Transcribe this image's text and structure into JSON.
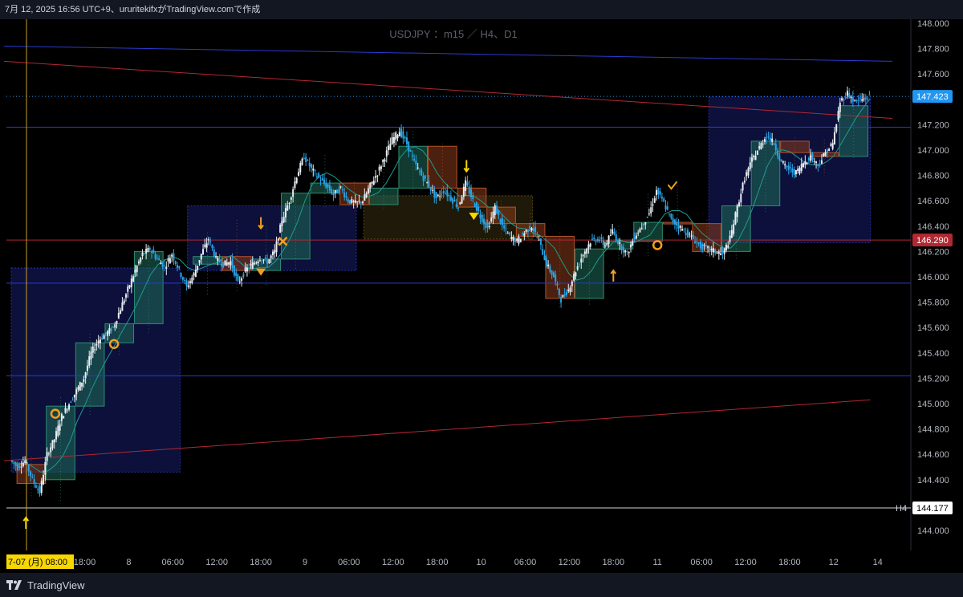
{
  "header": {
    "text": "7月 12, 2025 16:56 UTC+9、ururitekifxがTradingView.comで作成"
  },
  "footer": {
    "brand": "TradingView"
  },
  "chart_data": {
    "type": "candlestick",
    "symbol_label": "USDJPY ：m15 ／ H4、D1",
    "y_ticks": [
      "148.000",
      "147.800",
      "147.600",
      "147.400",
      "147.200",
      "147.000",
      "146.800",
      "146.600",
      "146.400",
      "146.200",
      "146.000",
      "145.800",
      "145.600",
      "145.400",
      "145.200",
      "145.000",
      "144.800",
      "144.600",
      "144.400",
      "144.200",
      "144.000"
    ],
    "ylim": [
      143.85,
      148.05
    ],
    "x_ticks": [
      {
        "t": 0,
        "label": "7-07 (月)  08:00",
        "highlight": true
      },
      {
        "t": 10,
        "label": "18:00"
      },
      {
        "t": 16,
        "label": "8"
      },
      {
        "t": 22,
        "label": "06:00"
      },
      {
        "t": 28,
        "label": "12:00"
      },
      {
        "t": 34,
        "label": "18:00"
      },
      {
        "t": 40,
        "label": "9"
      },
      {
        "t": 46,
        "label": "06:00"
      },
      {
        "t": 52,
        "label": "12:00"
      },
      {
        "t": 58,
        "label": "18:00"
      },
      {
        "t": 64,
        "label": "10"
      },
      {
        "t": 70,
        "label": "06:00"
      },
      {
        "t": 76,
        "label": "12:00"
      },
      {
        "t": 82,
        "label": "18:00"
      },
      {
        "t": 88,
        "label": "11"
      },
      {
        "t": 94,
        "label": "06:00"
      },
      {
        "t": 100,
        "label": "12:00"
      },
      {
        "t": 106,
        "label": "18:00"
      },
      {
        "t": 112,
        "label": "12"
      },
      {
        "t": 118,
        "label": "14"
      }
    ],
    "price_labels": [
      {
        "value": 147.423,
        "label": "147.423",
        "color": "#2196f3",
        "text_color": "#ffffff"
      },
      {
        "value": 146.29,
        "label": "146.290",
        "color": "#b22833",
        "text_color": "#ffffff"
      },
      {
        "value": 144.177,
        "label": "144.177",
        "color": "#ffffff",
        "text_color": "#000000",
        "tag": "H4"
      }
    ],
    "horizontal_lines": [
      {
        "value": 146.29,
        "color": "#b22833"
      },
      {
        "value": 145.95,
        "color": "#2a3bd1"
      },
      {
        "value": 145.22,
        "color": "#2a3bd1"
      },
      {
        "value": 147.18,
        "color": "#2a3bd1"
      },
      {
        "value": 144.177,
        "color": "#d1d4dc"
      }
    ],
    "trend_lines": [
      {
        "t1": -1,
        "p1": 147.82,
        "t2": 120,
        "p2": 147.7,
        "color": "#2a3bd1"
      },
      {
        "t1": -1,
        "p1": 147.7,
        "t2": 120,
        "p2": 147.25,
        "color": "#b22833"
      },
      {
        "t1": -1,
        "p1": 144.55,
        "t2": 117,
        "p2": 145.03,
        "color": "#b22833"
      }
    ],
    "zones": [
      {
        "t1": 0,
        "t2": 23,
        "p1": 144.46,
        "p2": 146.07,
        "color": "#2a3bd1"
      },
      {
        "t1": 24,
        "t2": 47,
        "p1": 146.05,
        "p2": 146.56,
        "color": "#2a3bd1"
      },
      {
        "t1": 95,
        "t2": 117,
        "p1": 146.27,
        "p2": 147.42,
        "color": "#2a3bd1"
      },
      {
        "t1": 48,
        "t2": 71,
        "p1": 146.3,
        "p2": 146.64,
        "color": "#6b5a1e"
      }
    ],
    "h4_boxes": [
      {
        "t": 1,
        "open": 144.52,
        "close": 144.37,
        "high": 144.58,
        "low": 144.25
      },
      {
        "t": 5,
        "open": 144.4,
        "close": 144.98,
        "high": 145.05,
        "low": 144.22
      },
      {
        "t": 9,
        "open": 144.98,
        "close": 145.48,
        "high": 145.55,
        "low": 144.9
      },
      {
        "t": 13,
        "open": 145.48,
        "close": 145.63,
        "high": 145.72,
        "low": 145.38
      },
      {
        "t": 17,
        "open": 145.63,
        "close": 146.2,
        "high": 146.25,
        "low": 145.55
      },
      {
        "t": 25,
        "open": 146.1,
        "close": 146.16,
        "high": 146.35,
        "low": 145.85
      },
      {
        "t": 29,
        "open": 146.16,
        "close": 146.05,
        "high": 146.45,
        "low": 145.88
      },
      {
        "t": 33,
        "open": 146.05,
        "close": 146.14,
        "high": 146.4,
        "low": 145.92
      },
      {
        "t": 37,
        "open": 146.14,
        "close": 146.66,
        "high": 146.78,
        "low": 146.05
      },
      {
        "t": 41,
        "open": 146.66,
        "close": 146.74,
        "high": 146.96,
        "low": 146.55
      },
      {
        "t": 45,
        "open": 146.74,
        "close": 146.57,
        "high": 146.75,
        "low": 146.52
      },
      {
        "t": 49,
        "open": 146.57,
        "close": 146.7,
        "high": 146.9,
        "low": 146.52
      },
      {
        "t": 53,
        "open": 146.7,
        "close": 147.03,
        "high": 147.15,
        "low": 146.62
      },
      {
        "t": 57,
        "open": 147.03,
        "close": 146.7,
        "high": 147.05,
        "low": 146.6
      },
      {
        "t": 61,
        "open": 146.7,
        "close": 146.55,
        "high": 146.76,
        "low": 146.5
      },
      {
        "t": 65,
        "open": 146.55,
        "close": 146.42,
        "high": 146.6,
        "low": 146.3
      },
      {
        "t": 69,
        "open": 146.42,
        "close": 146.32,
        "high": 146.5,
        "low": 146.25
      },
      {
        "t": 73,
        "open": 146.32,
        "close": 145.83,
        "high": 146.35,
        "low": 145.76
      },
      {
        "t": 77,
        "open": 145.83,
        "close": 146.22,
        "high": 146.32,
        "low": 145.78
      },
      {
        "t": 81,
        "open": 146.22,
        "close": 146.28,
        "high": 146.4,
        "low": 146.12
      },
      {
        "t": 85,
        "open": 146.28,
        "close": 146.43,
        "high": 146.65,
        "low": 146.15
      },
      {
        "t": 89,
        "open": 146.43,
        "close": 146.42,
        "high": 146.72,
        "low": 146.35
      },
      {
        "t": 93,
        "open": 146.42,
        "close": 146.2,
        "high": 146.45,
        "low": 146.15
      },
      {
        "t": 97,
        "open": 146.2,
        "close": 146.56,
        "high": 146.58,
        "low": 146.14
      },
      {
        "t": 101,
        "open": 146.56,
        "close": 147.07,
        "high": 147.15,
        "low": 146.5
      },
      {
        "t": 105,
        "open": 147.07,
        "close": 146.98,
        "high": 147.1,
        "low": 146.8
      },
      {
        "t": 109,
        "open": 146.98,
        "close": 146.95,
        "high": 147.08,
        "low": 146.8
      },
      {
        "t": 113,
        "open": 146.95,
        "close": 147.35,
        "high": 147.5,
        "low": 146.92
      }
    ],
    "path": [
      [
        0,
        144.55
      ],
      [
        1,
        144.5
      ],
      [
        2,
        144.55
      ],
      [
        3,
        144.4
      ],
      [
        4,
        144.3
      ],
      [
        5,
        144.6
      ],
      [
        6,
        144.72
      ],
      [
        7,
        144.9
      ],
      [
        8,
        145.0
      ],
      [
        9,
        145.1
      ],
      [
        10,
        145.2
      ],
      [
        11,
        145.4
      ],
      [
        12,
        145.5
      ],
      [
        13,
        145.55
      ],
      [
        14,
        145.6
      ],
      [
        15,
        145.75
      ],
      [
        16,
        145.9
      ],
      [
        17,
        146.05
      ],
      [
        18,
        146.18
      ],
      [
        19,
        146.22
      ],
      [
        20,
        146.14
      ],
      [
        21,
        146.08
      ],
      [
        22,
        146.18
      ],
      [
        23,
        146.05
      ],
      [
        24,
        145.92
      ],
      [
        25,
        146.02
      ],
      [
        26,
        146.18
      ],
      [
        27,
        146.3
      ],
      [
        28,
        146.14
      ],
      [
        29,
        146.1
      ],
      [
        30,
        146.12
      ],
      [
        31,
        145.95
      ],
      [
        32,
        146.05
      ],
      [
        33,
        146.1
      ],
      [
        34,
        146.15
      ],
      [
        35,
        146.12
      ],
      [
        36,
        146.2
      ],
      [
        37,
        146.45
      ],
      [
        38,
        146.6
      ],
      [
        39,
        146.8
      ],
      [
        40,
        146.95
      ],
      [
        41,
        146.85
      ],
      [
        42,
        146.78
      ],
      [
        43,
        146.72
      ],
      [
        44,
        146.65
      ],
      [
        45,
        146.7
      ],
      [
        46,
        146.6
      ],
      [
        47,
        146.58
      ],
      [
        48,
        146.6
      ],
      [
        49,
        146.72
      ],
      [
        50,
        146.82
      ],
      [
        51,
        146.95
      ],
      [
        52,
        147.08
      ],
      [
        53,
        147.15
      ],
      [
        54,
        147.05
      ],
      [
        55,
        146.9
      ],
      [
        56,
        146.8
      ],
      [
        57,
        146.72
      ],
      [
        58,
        146.62
      ],
      [
        59,
        146.68
      ],
      [
        60,
        146.62
      ],
      [
        61,
        146.55
      ],
      [
        62,
        146.74
      ],
      [
        63,
        146.6
      ],
      [
        64,
        146.48
      ],
      [
        65,
        146.38
      ],
      [
        66,
        146.55
      ],
      [
        67,
        146.4
      ],
      [
        68,
        146.32
      ],
      [
        69,
        146.28
      ],
      [
        70,
        146.35
      ],
      [
        71,
        146.4
      ],
      [
        72,
        146.28
      ],
      [
        73,
        146.1
      ],
      [
        74,
        146.0
      ],
      [
        75,
        145.82
      ],
      [
        76,
        145.9
      ],
      [
        77,
        146.05
      ],
      [
        78,
        146.18
      ],
      [
        79,
        146.28
      ],
      [
        80,
        146.3
      ],
      [
        81,
        146.25
      ],
      [
        82,
        146.36
      ],
      [
        83,
        146.25
      ],
      [
        84,
        146.18
      ],
      [
        85,
        146.32
      ],
      [
        86,
        146.4
      ],
      [
        87,
        146.5
      ],
      [
        88,
        146.68
      ],
      [
        89,
        146.58
      ],
      [
        90,
        146.45
      ],
      [
        91,
        146.4
      ],
      [
        92,
        146.35
      ],
      [
        93,
        146.3
      ],
      [
        94,
        146.24
      ],
      [
        95,
        146.22
      ],
      [
        96,
        146.2
      ],
      [
        97,
        146.18
      ],
      [
        98,
        146.3
      ],
      [
        99,
        146.55
      ],
      [
        100,
        146.78
      ],
      [
        101,
        146.92
      ],
      [
        102,
        147.02
      ],
      [
        103,
        147.12
      ],
      [
        104,
        147.05
      ],
      [
        105,
        146.9
      ],
      [
        106,
        146.85
      ],
      [
        107,
        146.82
      ],
      [
        108,
        146.9
      ],
      [
        109,
        146.95
      ],
      [
        110,
        146.88
      ],
      [
        111,
        146.98
      ],
      [
        112,
        147.05
      ],
      [
        113,
        147.38
      ],
      [
        114,
        147.45
      ],
      [
        115,
        147.38
      ],
      [
        116,
        147.4
      ],
      [
        117,
        147.42
      ]
    ],
    "markers": [
      {
        "t": 6,
        "p": 144.92,
        "shape": "circle"
      },
      {
        "t": 14,
        "p": 145.47,
        "shape": "circle"
      },
      {
        "t": 37,
        "p": 146.28,
        "shape": "cross"
      },
      {
        "t": 34,
        "p": 146.04,
        "shape": "triangle-down"
      },
      {
        "t": 63,
        "p": 146.48,
        "shape": "triangle-down"
      },
      {
        "t": 88,
        "p": 146.25,
        "shape": "circle"
      },
      {
        "t": 90,
        "p": 146.72,
        "shape": "check"
      },
      {
        "t": 2,
        "p": 144.05,
        "shape": "arrow-up",
        "color": "#f7d700"
      },
      {
        "t": 34,
        "p": 146.42,
        "shape": "arrow-down"
      },
      {
        "t": 62,
        "p": 146.87,
        "shape": "arrow-down",
        "color": "#f7d700"
      },
      {
        "t": 82,
        "p": 146.0,
        "shape": "arrow-up"
      }
    ],
    "grid": false
  }
}
